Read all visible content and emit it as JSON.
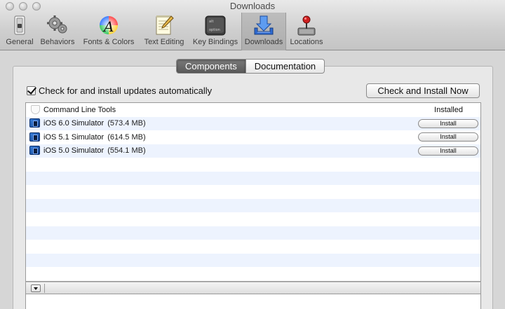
{
  "window": {
    "title": "Downloads"
  },
  "toolbar": {
    "items": [
      {
        "label": "General",
        "icon": "switch-icon"
      },
      {
        "label": "Behaviors",
        "icon": "gears-icon"
      },
      {
        "label": "Fonts & Colors",
        "icon": "color-wheel-font-icon"
      },
      {
        "label": "Text Editing",
        "icon": "notepad-pencil-icon"
      },
      {
        "label": "Key Bindings",
        "icon": "keyboard-option-key-icon"
      },
      {
        "label": "Downloads",
        "icon": "download-arrow-icon",
        "selected": true
      },
      {
        "label": "Locations",
        "icon": "joystick-drive-icon"
      }
    ]
  },
  "tabs": {
    "components": "Components",
    "documentation": "Documentation",
    "selected": "Components"
  },
  "auto_update": {
    "label": "Check for and install updates automatically",
    "checked": true
  },
  "check_button": {
    "label": "Check and Install Now"
  },
  "components": [
    {
      "name": "Command Line Tools",
      "size": "",
      "status": "Installed",
      "icon": "shield-icon"
    },
    {
      "name": "iOS 6.0 Simulator",
      "size": "(573.4 MB)",
      "action": "Install",
      "icon": "simulator-icon"
    },
    {
      "name": "iOS 5.1 Simulator",
      "size": "(614.5 MB)",
      "action": "Install",
      "icon": "simulator-icon"
    },
    {
      "name": "iOS 5.0 Simulator",
      "size": "(554.1 MB)",
      "action": "Install",
      "icon": "simulator-icon"
    }
  ],
  "colors": {
    "row_stripe": "#edf3fe",
    "selected_segment": "#6a6a6a"
  }
}
